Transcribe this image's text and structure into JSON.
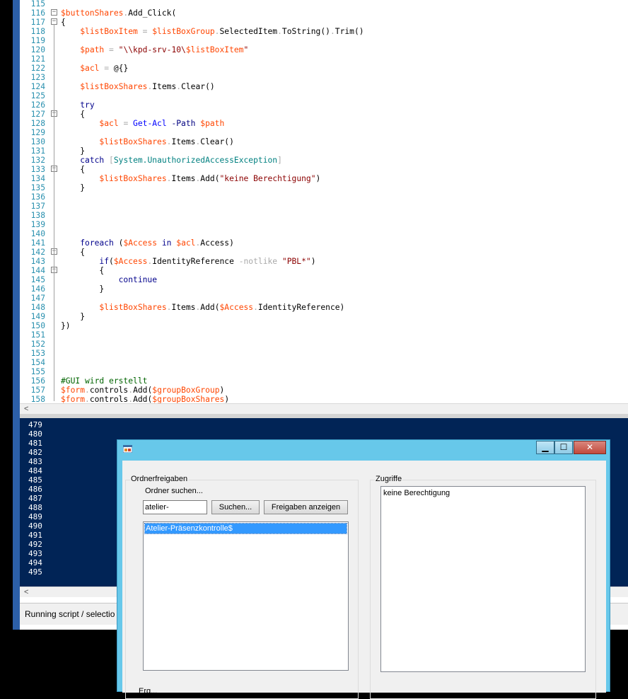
{
  "editor": {
    "lines": [
      {
        "n": "115",
        "tokens": []
      },
      {
        "n": "116",
        "fold": "-",
        "tokens": [
          {
            "t": "$buttonShares",
            "c": "var"
          },
          {
            "t": ".",
            "c": "op"
          },
          {
            "t": "Add_Click",
            "c": "member"
          },
          {
            "t": "(",
            "c": "plain"
          }
        ]
      },
      {
        "n": "117",
        "fold": "-",
        "tokens": [
          {
            "t": "{",
            "c": "plain"
          }
        ]
      },
      {
        "n": "118",
        "tokens": [
          {
            "t": "    ",
            "c": "plain"
          },
          {
            "t": "$listBoxItem",
            "c": "var"
          },
          {
            "t": " = ",
            "c": "op"
          },
          {
            "t": "$listBoxGroup",
            "c": "var"
          },
          {
            "t": ".",
            "c": "op"
          },
          {
            "t": "SelectedItem",
            "c": "member"
          },
          {
            "t": ".",
            "c": "op"
          },
          {
            "t": "ToString",
            "c": "member"
          },
          {
            "t": "()",
            "c": "plain"
          },
          {
            "t": ".",
            "c": "op"
          },
          {
            "t": "Trim",
            "c": "member"
          },
          {
            "t": "()",
            "c": "plain"
          }
        ]
      },
      {
        "n": "119",
        "tokens": []
      },
      {
        "n": "120",
        "tokens": [
          {
            "t": "    ",
            "c": "plain"
          },
          {
            "t": "$path",
            "c": "var"
          },
          {
            "t": " = ",
            "c": "op"
          },
          {
            "t": "\"\\\\kpd-srv-10\\",
            "c": "str"
          },
          {
            "t": "$listBoxItem",
            "c": "var"
          },
          {
            "t": "\"",
            "c": "str"
          }
        ]
      },
      {
        "n": "121",
        "tokens": []
      },
      {
        "n": "122",
        "tokens": [
          {
            "t": "    ",
            "c": "plain"
          },
          {
            "t": "$acl",
            "c": "var"
          },
          {
            "t": " = ",
            "c": "op"
          },
          {
            "t": "@{}",
            "c": "plain"
          }
        ]
      },
      {
        "n": "123",
        "tokens": []
      },
      {
        "n": "124",
        "tokens": [
          {
            "t": "    ",
            "c": "plain"
          },
          {
            "t": "$listBoxShares",
            "c": "var"
          },
          {
            "t": ".",
            "c": "op"
          },
          {
            "t": "Items",
            "c": "member"
          },
          {
            "t": ".",
            "c": "op"
          },
          {
            "t": "Clear",
            "c": "member"
          },
          {
            "t": "()",
            "c": "plain"
          }
        ]
      },
      {
        "n": "125",
        "tokens": []
      },
      {
        "n": "126",
        "tokens": [
          {
            "t": "    ",
            "c": "plain"
          },
          {
            "t": "try",
            "c": "kw"
          }
        ]
      },
      {
        "n": "127",
        "fold": "-",
        "tokens": [
          {
            "t": "    ",
            "c": "plain"
          },
          {
            "t": "{",
            "c": "plain"
          }
        ]
      },
      {
        "n": "128",
        "tokens": [
          {
            "t": "        ",
            "c": "plain"
          },
          {
            "t": "$acl",
            "c": "var"
          },
          {
            "t": " = ",
            "c": "op"
          },
          {
            "t": "Get-Acl",
            "c": "cmd"
          },
          {
            "t": " -Path ",
            "c": "param"
          },
          {
            "t": "$path",
            "c": "var"
          }
        ]
      },
      {
        "n": "129",
        "tokens": []
      },
      {
        "n": "130",
        "tokens": [
          {
            "t": "        ",
            "c": "plain"
          },
          {
            "t": "$listBoxShares",
            "c": "var"
          },
          {
            "t": ".",
            "c": "op"
          },
          {
            "t": "Items",
            "c": "member"
          },
          {
            "t": ".",
            "c": "op"
          },
          {
            "t": "Clear",
            "c": "member"
          },
          {
            "t": "()",
            "c": "plain"
          }
        ]
      },
      {
        "n": "131",
        "tokens": [
          {
            "t": "    ",
            "c": "plain"
          },
          {
            "t": "}",
            "c": "plain"
          }
        ]
      },
      {
        "n": "132",
        "tokens": [
          {
            "t": "    ",
            "c": "plain"
          },
          {
            "t": "catch",
            "c": "kw"
          },
          {
            "t": " ",
            "c": "plain"
          },
          {
            "t": "[",
            "c": "op"
          },
          {
            "t": "System.UnauthorizedAccessException",
            "c": "type"
          },
          {
            "t": "]",
            "c": "op"
          }
        ]
      },
      {
        "n": "133",
        "fold": "-",
        "tokens": [
          {
            "t": "    ",
            "c": "plain"
          },
          {
            "t": "{",
            "c": "plain"
          }
        ]
      },
      {
        "n": "134",
        "tokens": [
          {
            "t": "        ",
            "c": "plain"
          },
          {
            "t": "$listBoxShares",
            "c": "var"
          },
          {
            "t": ".",
            "c": "op"
          },
          {
            "t": "Items",
            "c": "member"
          },
          {
            "t": ".",
            "c": "op"
          },
          {
            "t": "Add",
            "c": "member"
          },
          {
            "t": "(",
            "c": "plain"
          },
          {
            "t": "\"keine Berechtigung\"",
            "c": "str"
          },
          {
            "t": ")",
            "c": "plain"
          }
        ]
      },
      {
        "n": "135",
        "tokens": [
          {
            "t": "    ",
            "c": "plain"
          },
          {
            "t": "}",
            "c": "plain"
          }
        ]
      },
      {
        "n": "136",
        "tokens": []
      },
      {
        "n": "137",
        "tokens": []
      },
      {
        "n": "138",
        "tokens": []
      },
      {
        "n": "139",
        "tokens": []
      },
      {
        "n": "140",
        "tokens": []
      },
      {
        "n": "141",
        "tokens": [
          {
            "t": "    ",
            "c": "plain"
          },
          {
            "t": "foreach",
            "c": "kw"
          },
          {
            "t": " (",
            "c": "plain"
          },
          {
            "t": "$Access",
            "c": "var"
          },
          {
            "t": " in ",
            "c": "kw"
          },
          {
            "t": "$acl",
            "c": "var"
          },
          {
            "t": ".",
            "c": "op"
          },
          {
            "t": "Access",
            "c": "member"
          },
          {
            "t": ")",
            "c": "plain"
          }
        ]
      },
      {
        "n": "142",
        "fold": "-",
        "tokens": [
          {
            "t": "    ",
            "c": "plain"
          },
          {
            "t": "{",
            "c": "plain"
          }
        ]
      },
      {
        "n": "143",
        "tokens": [
          {
            "t": "        ",
            "c": "plain"
          },
          {
            "t": "if",
            "c": "kw"
          },
          {
            "t": "(",
            "c": "plain"
          },
          {
            "t": "$Access",
            "c": "var"
          },
          {
            "t": ".",
            "c": "op"
          },
          {
            "t": "IdentityReference",
            "c": "member"
          },
          {
            "t": " -notlike ",
            "c": "op"
          },
          {
            "t": "\"PBL*\"",
            "c": "str"
          },
          {
            "t": ")",
            "c": "plain"
          }
        ]
      },
      {
        "n": "144",
        "fold": "-",
        "tokens": [
          {
            "t": "        ",
            "c": "plain"
          },
          {
            "t": "{",
            "c": "plain"
          }
        ]
      },
      {
        "n": "145",
        "tokens": [
          {
            "t": "            ",
            "c": "plain"
          },
          {
            "t": "continue",
            "c": "kw"
          }
        ]
      },
      {
        "n": "146",
        "tokens": [
          {
            "t": "        ",
            "c": "plain"
          },
          {
            "t": "}",
            "c": "plain"
          }
        ]
      },
      {
        "n": "147",
        "tokens": []
      },
      {
        "n": "148",
        "tokens": [
          {
            "t": "        ",
            "c": "plain"
          },
          {
            "t": "$listBoxShares",
            "c": "var"
          },
          {
            "t": ".",
            "c": "op"
          },
          {
            "t": "Items",
            "c": "member"
          },
          {
            "t": ".",
            "c": "op"
          },
          {
            "t": "Add",
            "c": "member"
          },
          {
            "t": "(",
            "c": "plain"
          },
          {
            "t": "$Access",
            "c": "var"
          },
          {
            "t": ".",
            "c": "op"
          },
          {
            "t": "IdentityReference",
            "c": "member"
          },
          {
            "t": ")",
            "c": "plain"
          }
        ]
      },
      {
        "n": "149",
        "tokens": [
          {
            "t": "    ",
            "c": "plain"
          },
          {
            "t": "}",
            "c": "plain"
          }
        ]
      },
      {
        "n": "150",
        "tokens": [
          {
            "t": "})",
            "c": "plain"
          }
        ]
      },
      {
        "n": "151",
        "tokens": []
      },
      {
        "n": "152",
        "tokens": []
      },
      {
        "n": "153",
        "tokens": []
      },
      {
        "n": "154",
        "tokens": []
      },
      {
        "n": "155",
        "tokens": []
      },
      {
        "n": "156",
        "tokens": [
          {
            "t": "#GUI wird erstellt",
            "c": "comment"
          }
        ]
      },
      {
        "n": "157",
        "tokens": [
          {
            "t": "$form",
            "c": "var"
          },
          {
            "t": ".",
            "c": "op"
          },
          {
            "t": "controls",
            "c": "member"
          },
          {
            "t": ".",
            "c": "op"
          },
          {
            "t": "Add",
            "c": "member"
          },
          {
            "t": "(",
            "c": "plain"
          },
          {
            "t": "$groupBoxGroup",
            "c": "var"
          },
          {
            "t": ")",
            "c": "plain"
          }
        ]
      },
      {
        "n": "158",
        "tokens": [
          {
            "t": "$form",
            "c": "var"
          },
          {
            "t": ".",
            "c": "op"
          },
          {
            "t": "controls",
            "c": "member"
          },
          {
            "t": ".",
            "c": "op"
          },
          {
            "t": "Add",
            "c": "member"
          },
          {
            "t": "(",
            "c": "plain"
          },
          {
            "t": "$groupBoxShares",
            "c": "var"
          },
          {
            "t": ")",
            "c": "plain"
          }
        ]
      }
    ]
  },
  "scroll_arrow": "<",
  "console": {
    "line_numbers": [
      "479",
      "480",
      "481",
      "482",
      "483",
      "484",
      "485",
      "486",
      "487",
      "488",
      "489",
      "490",
      "491",
      "492",
      "493",
      "494",
      "495"
    ]
  },
  "status": {
    "text": "Running script / selectio"
  },
  "dialog": {
    "caption_buttons": {
      "minimize": "▁",
      "maximize": "☐",
      "close": "✕"
    },
    "group_shares": {
      "title": "Ordnerfreigaben",
      "search_label": "Ordner suchen...",
      "search_value": "atelier-",
      "search_button": "Suchen...",
      "show_button": "Freigaben anzeigen",
      "items": [
        "Atelier-Präsenzkontrolle$"
      ]
    },
    "group_access": {
      "title": "Zugriffe",
      "items": [
        "keine Berechtigung"
      ]
    },
    "bottom_label": "Erg..."
  },
  "colors": {
    "var": "#ff4500",
    "member": "#000000",
    "op": "#a9a9a9",
    "str": "#8b0000",
    "kw": "#00008b",
    "cmd": "#0000ff",
    "param": "#000080",
    "type": "#008080",
    "comment": "#006400",
    "plain": "#000000",
    "console_bg": "#012456",
    "dialog_caption": "#67c8ea",
    "selection": "#3399ff"
  }
}
